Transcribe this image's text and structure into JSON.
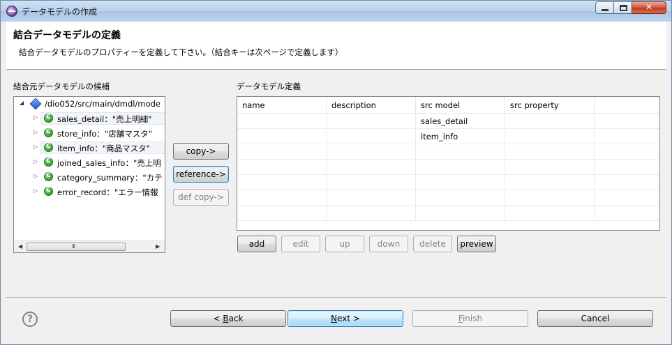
{
  "window": {
    "title": "データモデルの作成"
  },
  "header": {
    "title": "結合データモデルの定義",
    "description": "結合データモデルのプロパティーを定義して下さい。（結合キーは次ページで定義します）"
  },
  "left_panel": {
    "label": "結合元データモデルの候補",
    "root": "/dio052/src/main/dmdl/mode",
    "items": [
      {
        "label": "sales_detail：\"売上明細\"",
        "selected": true
      },
      {
        "label": "store_info：\"店舗マスタ\"",
        "selected": false
      },
      {
        "label": "item_info：\"商品マスタ\"",
        "selected": true
      },
      {
        "label": "joined_sales_info：\"売上明",
        "selected": false
      },
      {
        "label": "category_summary：\"カテ",
        "selected": false
      },
      {
        "label": "error_record：\"エラー情報",
        "selected": false
      }
    ],
    "scroll_grip": "III"
  },
  "middle_buttons": {
    "copy": "copy->",
    "reference": "reference->",
    "def_copy": "def copy->"
  },
  "right_panel": {
    "label": "データモデル定義",
    "columns": [
      "name",
      "description",
      "src model",
      "src property"
    ],
    "rows": [
      [
        "",
        "",
        "sales_detail",
        ""
      ],
      [
        "",
        "",
        "item_info",
        ""
      ],
      [
        "",
        "",
        "",
        ""
      ],
      [
        "",
        "",
        "",
        ""
      ],
      [
        "",
        "",
        "",
        ""
      ],
      [
        "",
        "",
        "",
        ""
      ],
      [
        "",
        "",
        "",
        ""
      ]
    ],
    "buttons": {
      "add": "add",
      "edit": "edit",
      "up": "up",
      "down": "down",
      "delete": "delete",
      "preview": "preview"
    }
  },
  "footer": {
    "help": "?",
    "back_prefix": "< ",
    "back_mnemonic": "B",
    "back_rest": "ack",
    "next_mnemonic": "N",
    "next_rest": "ext >",
    "finish_mnemonic": "F",
    "finish_rest": "inish",
    "cancel": "Cancel"
  }
}
